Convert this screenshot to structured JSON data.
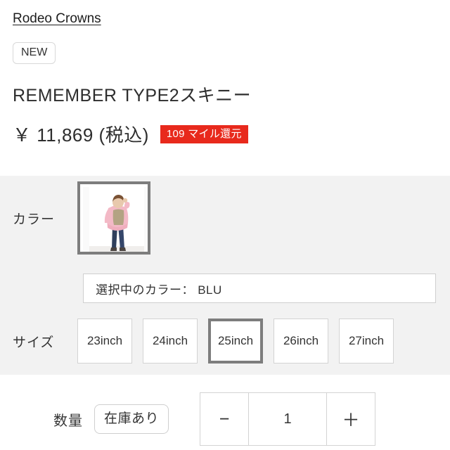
{
  "brand": {
    "name": "Rodeo Crowns"
  },
  "badges": {
    "new_label": "NEW"
  },
  "product": {
    "title": "REMEMBER TYPE2スキニー",
    "price_text": "￥ 11,869 (税込)",
    "mile_badge": "109 マイル還元",
    "mile_badge_color": "#e8291c"
  },
  "options": {
    "color": {
      "label": "カラー",
      "swatch_name": "BLU",
      "swatch_icon": "model-photo-thumbnail",
      "selected_text": "選択中のカラー： BLU"
    },
    "size": {
      "label": "サイズ",
      "items": [
        {
          "label": "23inch",
          "selected": false
        },
        {
          "label": "24inch",
          "selected": false
        },
        {
          "label": "25inch",
          "selected": true
        },
        {
          "label": "26inch",
          "selected": false
        },
        {
          "label": "27inch",
          "selected": false
        }
      ]
    }
  },
  "quantity": {
    "label": "数量",
    "stock_status": "在庫あり",
    "decrement_icon": "−",
    "value": "1",
    "increment_icon": "＋"
  }
}
